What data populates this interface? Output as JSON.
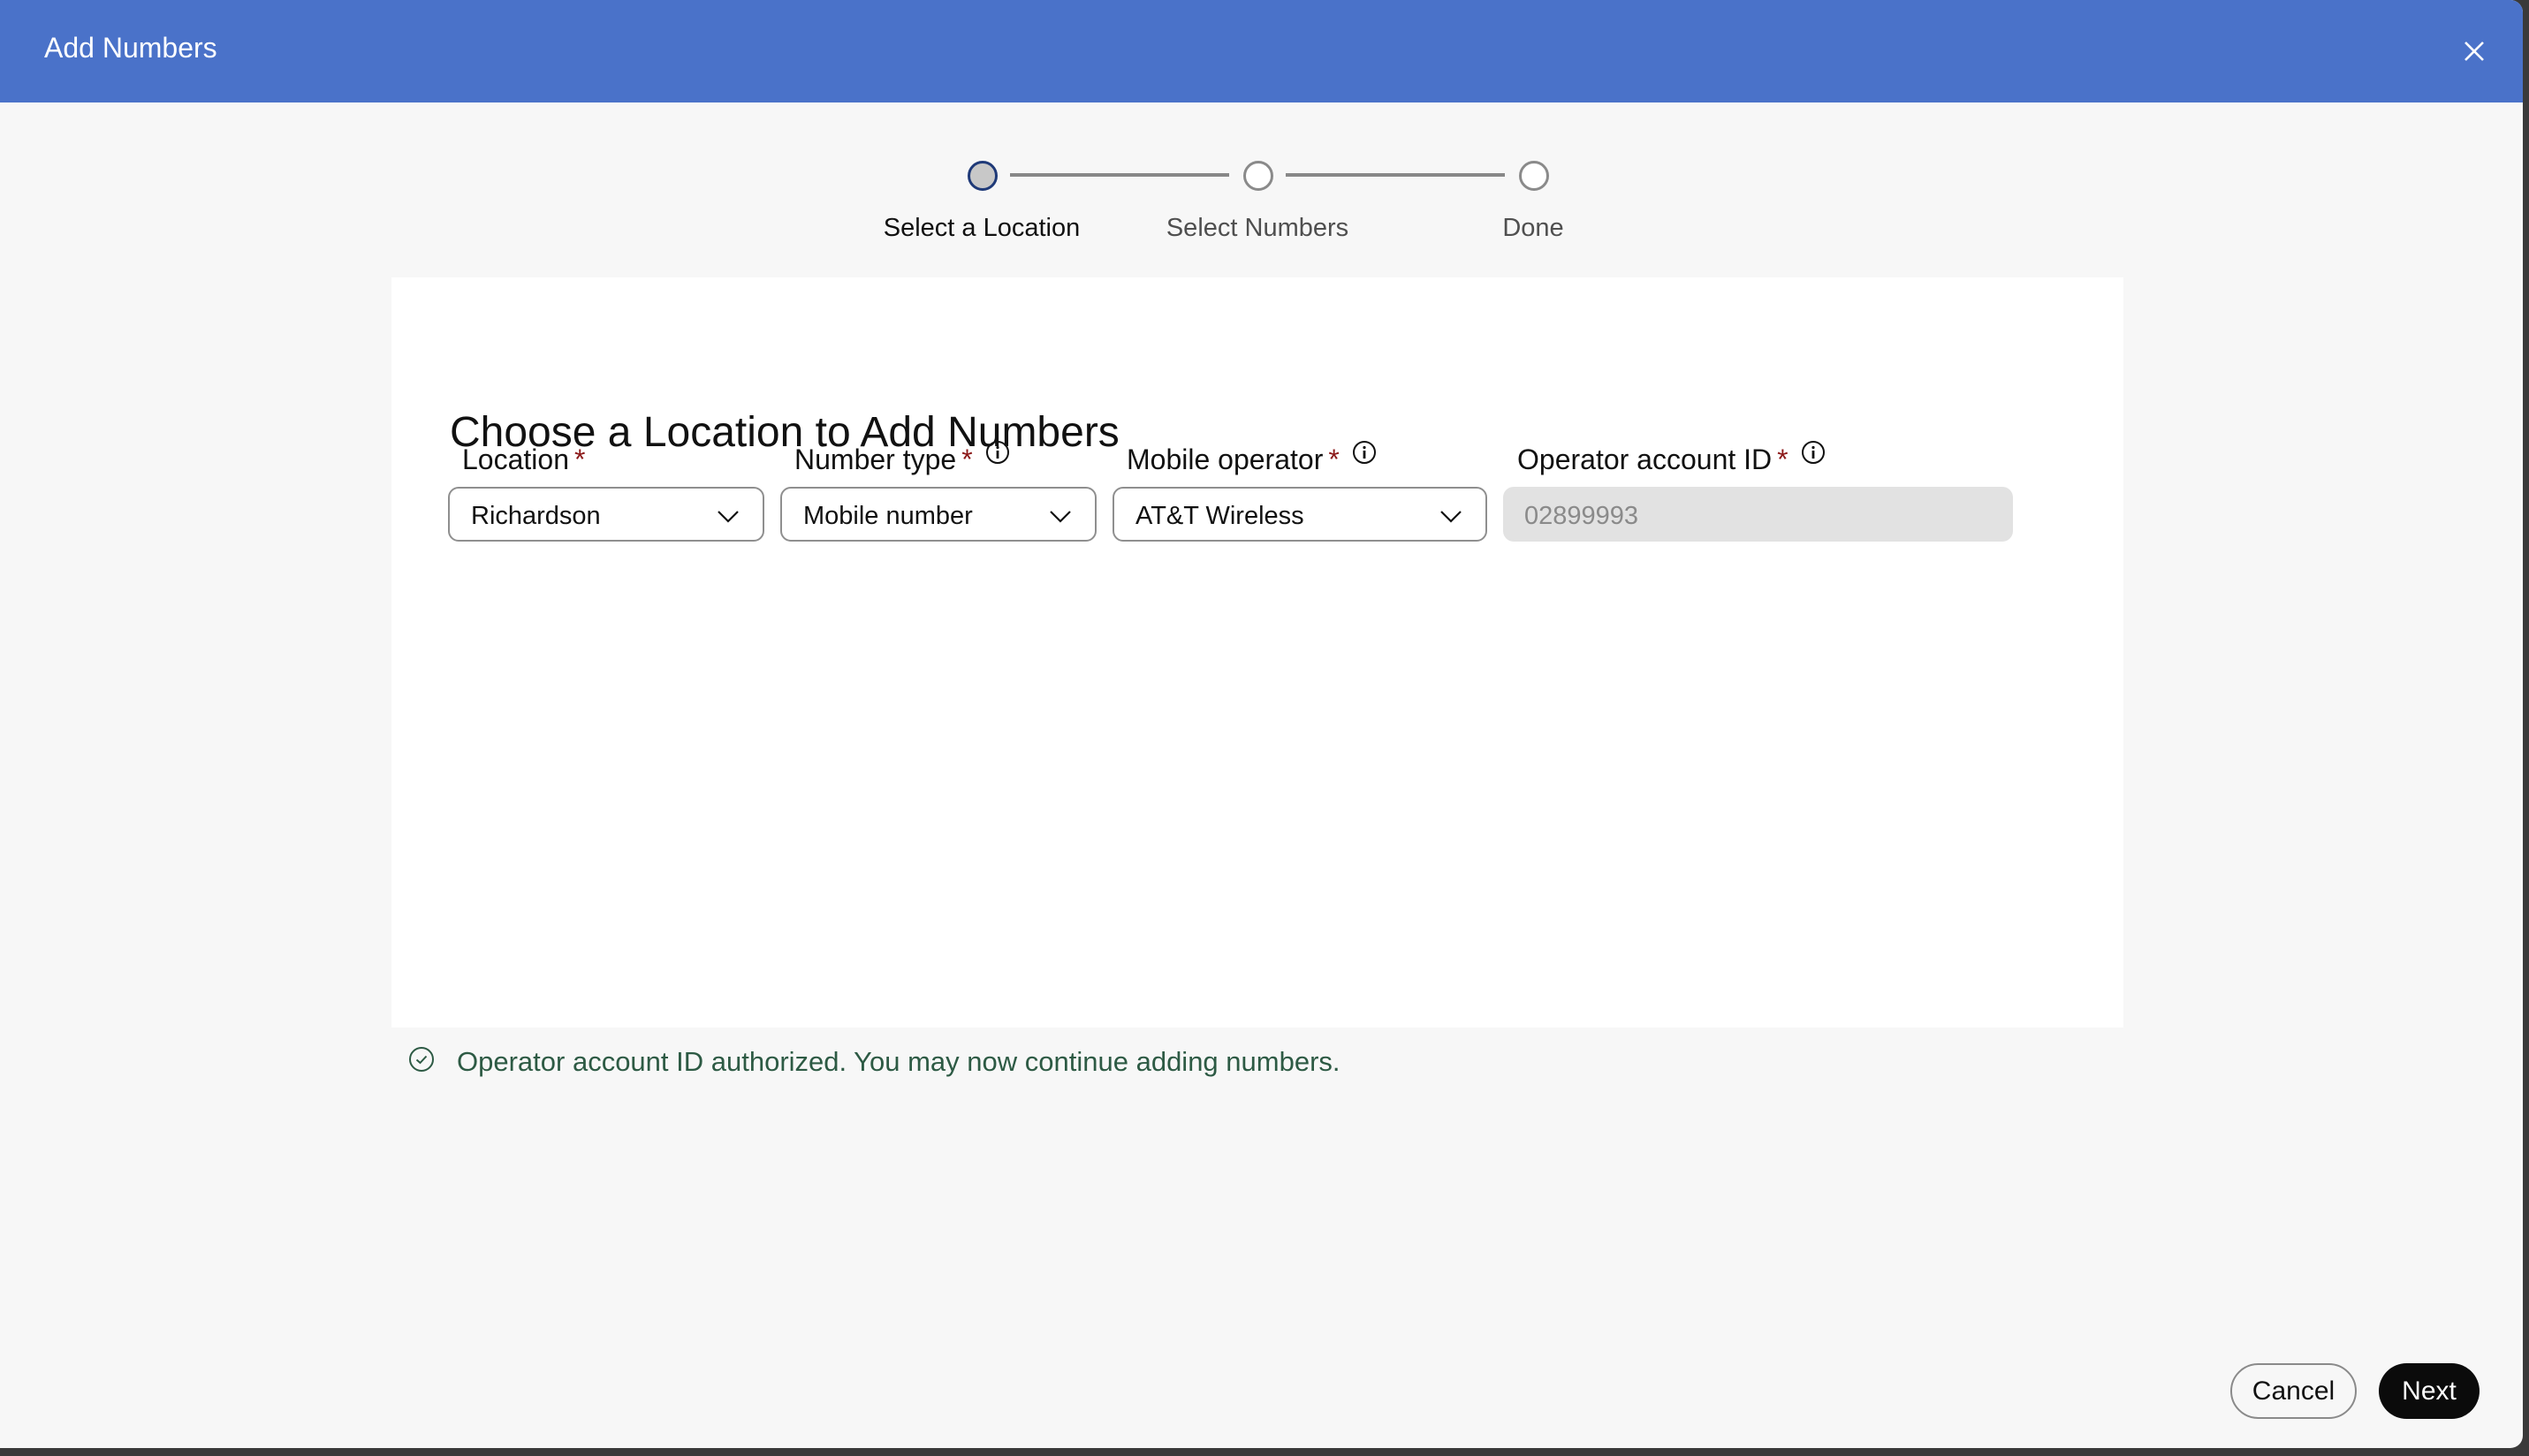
{
  "dialog": {
    "title": "Add Numbers",
    "close_icon": "close-icon"
  },
  "stepper": {
    "steps": [
      {
        "label": "Select a Location",
        "state": "active"
      },
      {
        "label": "Select Numbers",
        "state": "inactive"
      },
      {
        "label": "Done",
        "state": "inactive"
      }
    ]
  },
  "form": {
    "heading": "Choose a Location to Add Numbers",
    "required_marker": "*",
    "fields": [
      {
        "label": "Location",
        "required": true,
        "info": false,
        "type": "select",
        "value": "Richardson"
      },
      {
        "label": "Number type",
        "required": true,
        "info": true,
        "type": "select",
        "value": "Mobile number"
      },
      {
        "label": "Mobile operator",
        "required": true,
        "info": true,
        "type": "select",
        "value": "AT&T Wireless"
      },
      {
        "label": "Operator account ID",
        "required": true,
        "info": true,
        "type": "text",
        "disabled": true,
        "value": "02899993"
      }
    ]
  },
  "status": {
    "icon": "check-circle-icon",
    "message": "Operator account ID authorized. You may now continue adding numbers.",
    "color": "#2d5a44"
  },
  "footer": {
    "cancel_label": "Cancel",
    "next_label": "Next"
  },
  "colors": {
    "header": "#4a72c9",
    "active_step": "#1f3a78",
    "required": "#8c1a1a"
  }
}
